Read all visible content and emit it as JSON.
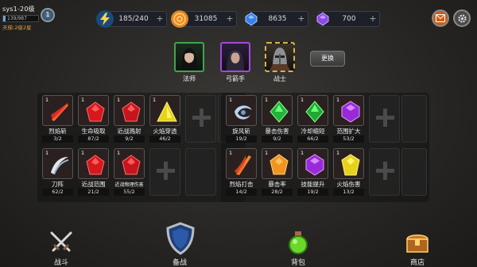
{
  "player": {
    "name": "sys1-20级",
    "exp": "139/987",
    "rank_level": "1",
    "ladder": "天梯:2级2星"
  },
  "resources": {
    "energy": "185/240",
    "gold": "31085",
    "gem": "8635",
    "purple": "700"
  },
  "heroes": [
    {
      "name": "法师"
    },
    {
      "name": "弓箭手"
    },
    {
      "name": "战士"
    }
  ],
  "swap_label": "更换",
  "left_panel": [
    {
      "level": "1",
      "name": "烈焰斩",
      "count": "3/2",
      "icon": "flame-slash-icon"
    },
    {
      "level": "1",
      "name": "生命吸取",
      "count": "87/2",
      "icon": "red-gem-icon"
    },
    {
      "level": "1",
      "name": "近战溅射",
      "count": "9/2",
      "icon": "red-gem-icon"
    },
    {
      "level": "1",
      "name": "火焰穿透",
      "count": "46/2",
      "icon": "yellow-gem-icon"
    },
    {
      "level": "1",
      "name": "刀阵",
      "count": "62/2",
      "icon": "blade-array-icon"
    },
    {
      "level": "1",
      "name": "近战范围",
      "count": "21/2",
      "icon": "red-gem-icon"
    },
    {
      "level": "1",
      "name": "近战物理伤害",
      "count": "55/2",
      "icon": "red-gem-icon"
    }
  ],
  "right_panel": [
    {
      "level": "1",
      "name": "旋风斩",
      "count": "19/2",
      "icon": "whirlwind-icon"
    },
    {
      "level": "1",
      "name": "暴击伤害",
      "count": "9/2",
      "icon": "green-gem-icon"
    },
    {
      "level": "1",
      "name": "冷却缩短",
      "count": "66/2",
      "icon": "green-gem-icon"
    },
    {
      "level": "1",
      "name": "范围扩大",
      "count": "53/2",
      "icon": "purple-gem-icon"
    },
    {
      "level": "1",
      "name": "烈焰打击",
      "count": "14/2",
      "icon": "flame-sword-icon"
    },
    {
      "level": "1",
      "name": "暴击率",
      "count": "28/2",
      "icon": "orange-gem-icon"
    },
    {
      "level": "1",
      "name": "技能提升",
      "count": "19/2",
      "icon": "purple-gem-icon"
    },
    {
      "level": "1",
      "name": "火焰伤害",
      "count": "13/2",
      "icon": "yellow-gem-icon"
    }
  ],
  "nav": {
    "battle": "战斗",
    "prepare": "备战",
    "bag": "背包",
    "shop": "商店"
  },
  "colors": {
    "energy_accent": "#ffd54a",
    "gold_coin": "#f08a24",
    "gem_blue": "#3a7ee8",
    "gem_purple": "#8a4ae8",
    "mail_button": "#c4601e",
    "ladder_text": "#e0a040"
  }
}
